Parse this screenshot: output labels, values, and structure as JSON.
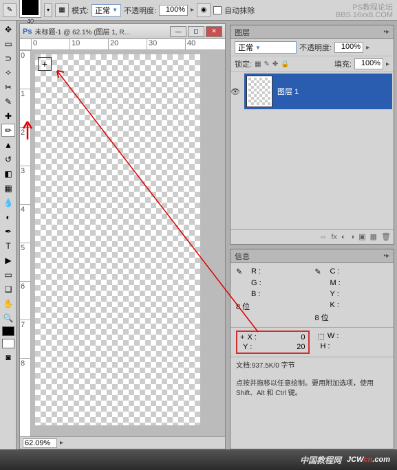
{
  "toolbar": {
    "brush_size": "40",
    "mode_label": "模式:",
    "mode_value": "正常",
    "opacity_label": "不透明度:",
    "opacity_value": "100%",
    "auto_erase_label": "自动抹除"
  },
  "watermark": {
    "line1": "PS教程论坛",
    "line2": "BBS.16xx8.COM"
  },
  "document": {
    "title": "未标题-1 @ 62.1% (图层 1, R...",
    "zoom": "62.09%",
    "ruler_h": [
      "0",
      "10",
      "20",
      "30",
      "40"
    ],
    "ruler_v": [
      "0",
      "1",
      "2",
      "3",
      "4",
      "5",
      "6",
      "7",
      "8"
    ]
  },
  "layers_panel": {
    "tab": "图层",
    "blend_mode": "正常",
    "opacity_label": "不透明度:",
    "opacity_value": "100%",
    "lock_label": "锁定:",
    "fill_label": "填充:",
    "fill_value": "100%",
    "layer_name": "图层 1"
  },
  "info_panel": {
    "tab": "信息",
    "r_label": "R :",
    "g_label": "G :",
    "b_label": "B :",
    "c_label": "C :",
    "m_label": "M :",
    "y_label": "Y :",
    "k_label": "K :",
    "bit_label": "8 位",
    "x_label": "X :",
    "x_value": "0",
    "y_value": "20",
    "w_label": "W :",
    "h_label": "H :",
    "doc_info": "文档:937.5K/0 字节",
    "hint": "点按并拖移以任意绘制。要用附加选项，使用 Shift、Alt 和 Ctrl 键。"
  },
  "footer": {
    "cn": "中国教程网",
    "brand1": "JCW",
    "brand2": "cn",
    "brand3": ".com"
  }
}
